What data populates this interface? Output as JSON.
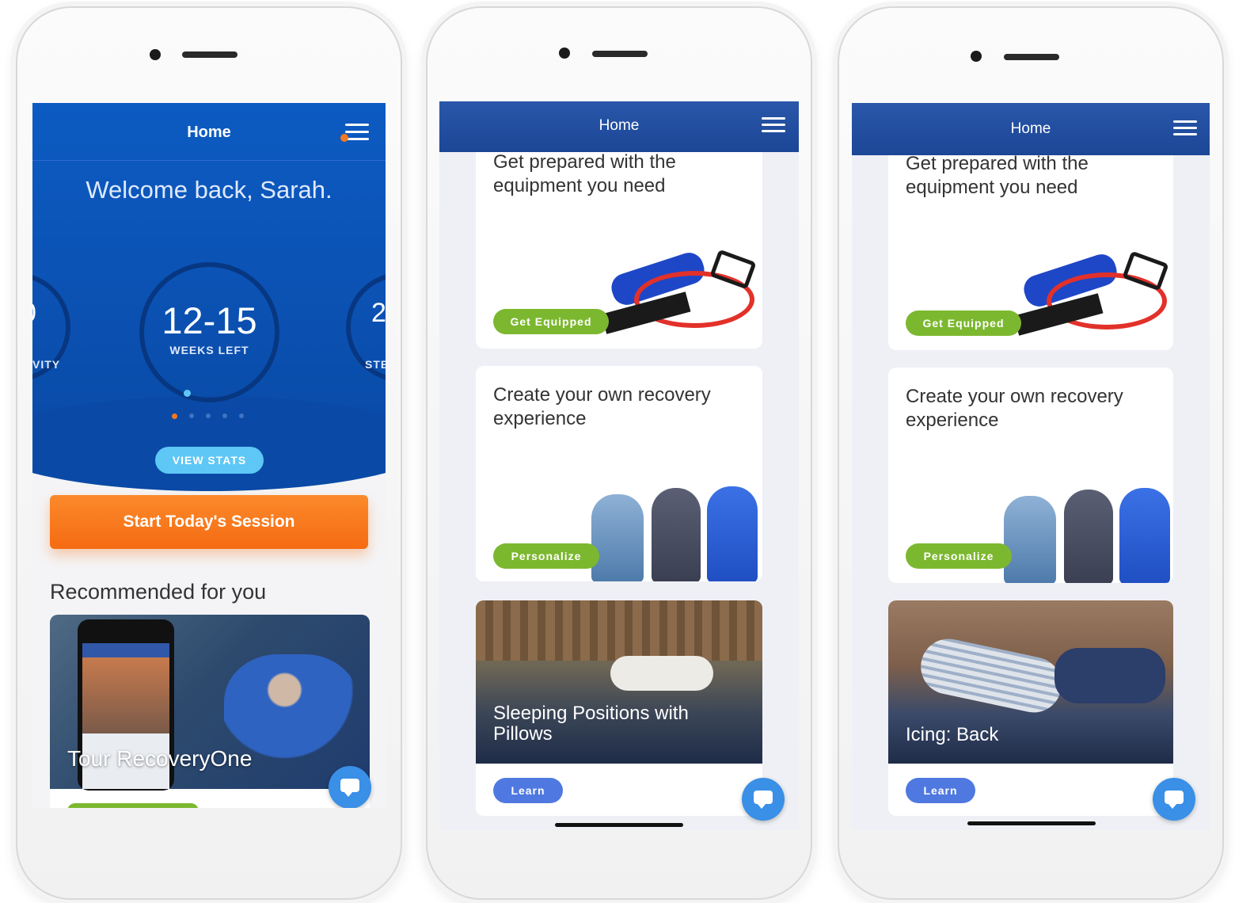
{
  "phone1": {
    "header": {
      "title": "Home"
    },
    "welcome": "Welcome back, Sarah.",
    "carousel": {
      "left_value": "0",
      "left_label": "VITY",
      "center_value": "12-15",
      "center_label": "WEEKS LEFT",
      "right_value": "2",
      "right_label": "STE"
    },
    "view_stats": "VIEW STATS",
    "start_session": "Start Today's Session",
    "recommended_heading": "Recommended for you",
    "tour_card_title": "Tour RecoveryOne"
  },
  "phone2": {
    "header": {
      "title": "Home"
    },
    "card1": {
      "title": "Get prepared with the equipment you need",
      "button": "Get Equipped"
    },
    "card2": {
      "title": "Create your own recovery experience",
      "button": "Personalize"
    },
    "card3": {
      "title": "Sleeping Positions with Pillows",
      "button": "Learn"
    }
  },
  "phone3": {
    "header": {
      "title": "Home"
    },
    "card1": {
      "title": "Get prepared with the equipment you need",
      "button": "Get Equipped"
    },
    "card2": {
      "title": "Create your own recovery experience",
      "button": "Personalize"
    },
    "card3": {
      "title": "Icing: Back",
      "button": "Learn"
    }
  },
  "colors": {
    "primary_blue": "#0c5bc2",
    "header_blue": "#1c4696",
    "orange": "#f7781e",
    "green": "#7cb82f",
    "learn_blue": "#4f79e0",
    "light_blue": "#5ec7f5"
  },
  "icons": [
    "menu-icon",
    "chat-icon",
    "camera-icon",
    "speaker-icon"
  ]
}
